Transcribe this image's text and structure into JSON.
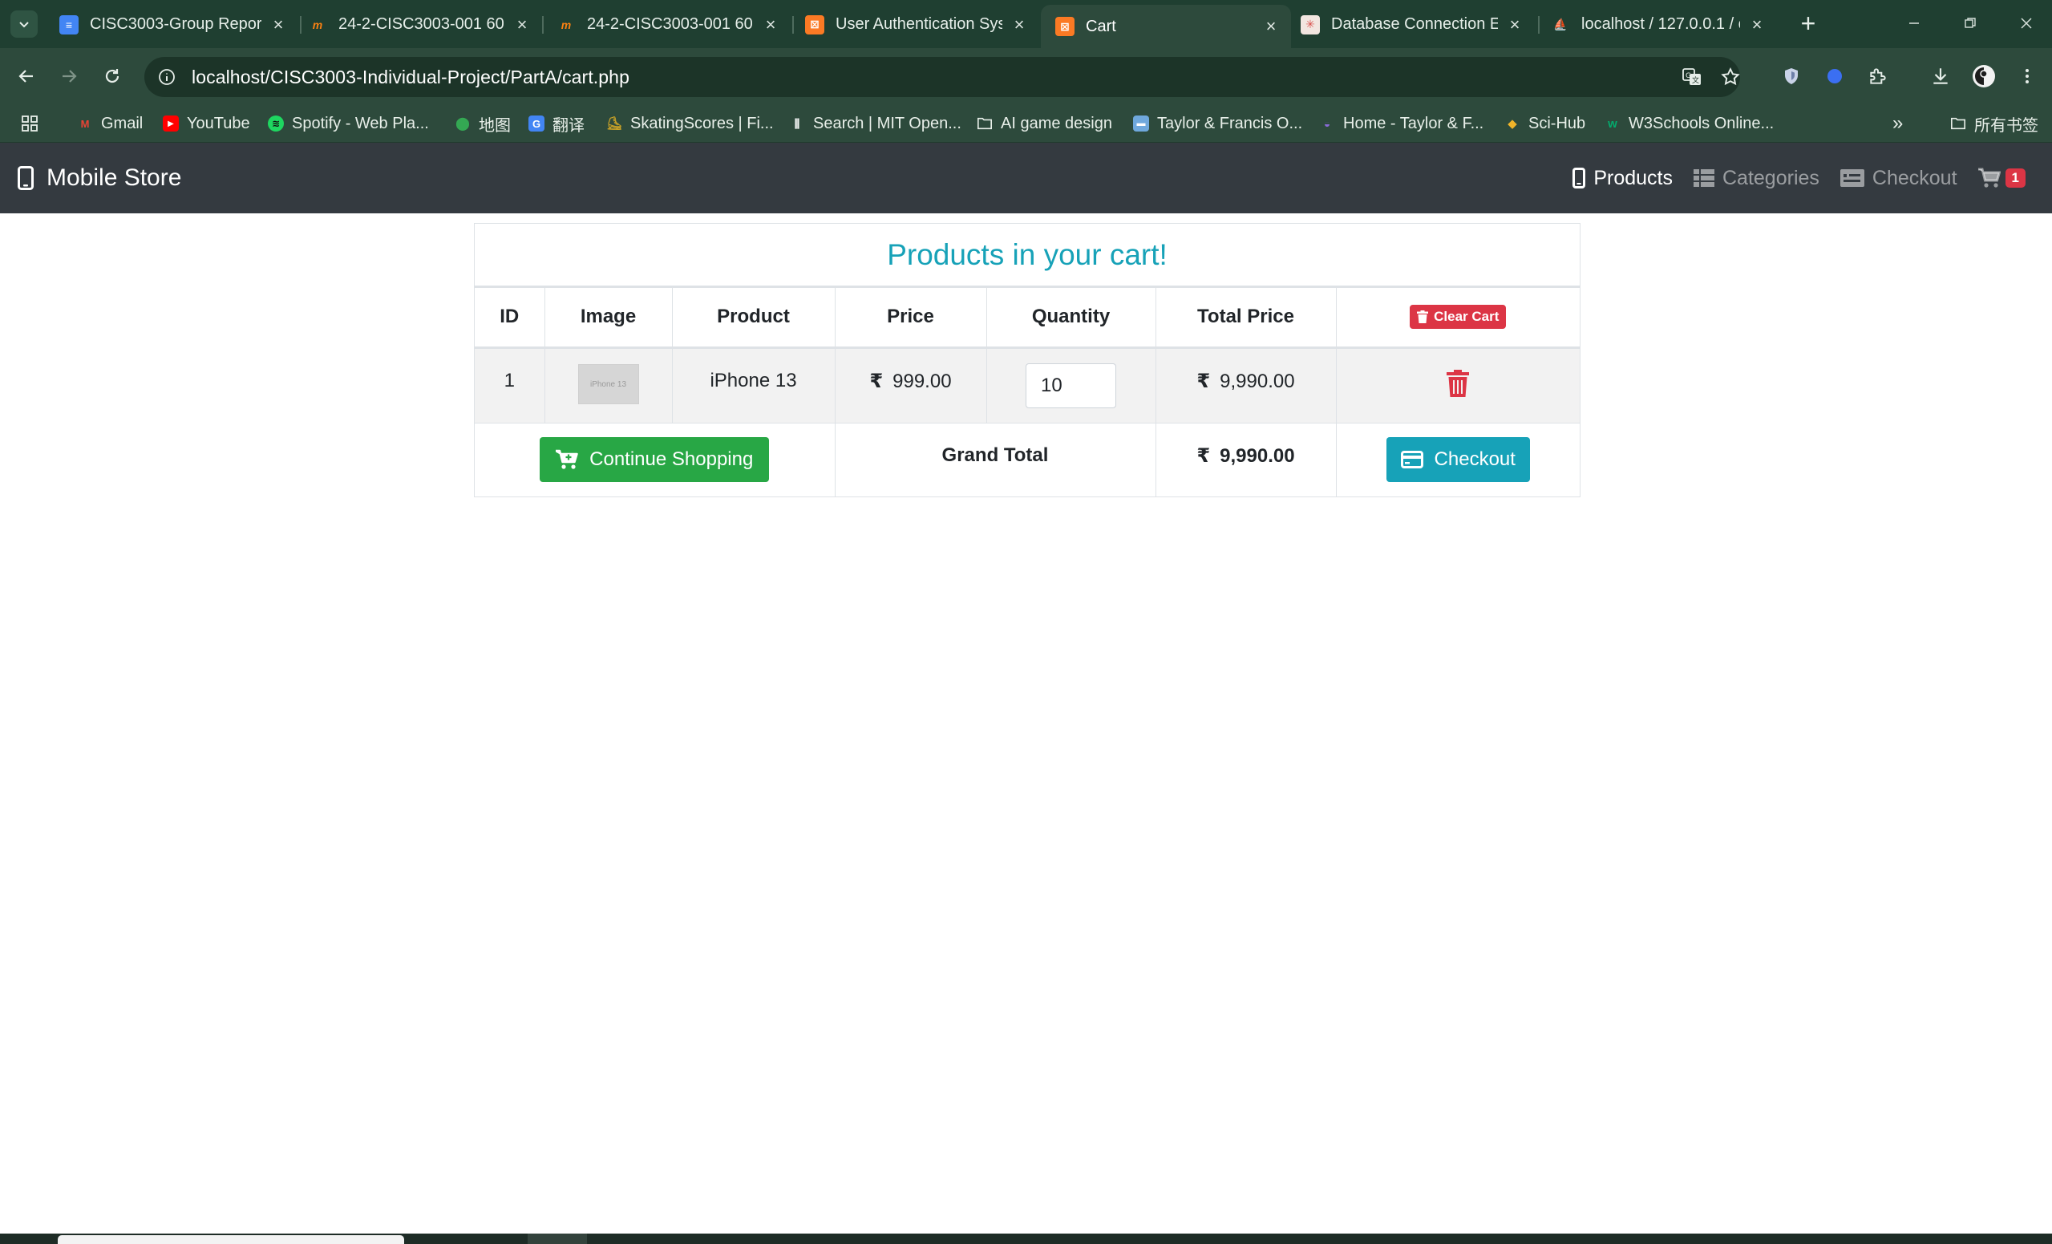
{
  "browser": {
    "tabs": [
      {
        "title": "CISC3003-Group Repor",
        "favicon": "docs-icon",
        "color": "#4285f4",
        "active": false
      },
      {
        "title": "24-2-CISC3003-001 60(",
        "favicon": "moodle-icon",
        "color": "#f98012",
        "active": false
      },
      {
        "title": "24-2-CISC3003-001 60(",
        "favicon": "moodle-icon",
        "color": "#f98012",
        "active": false
      },
      {
        "title": "User Authentication Sys",
        "favicon": "xampp-icon",
        "color": "#fb7a24",
        "active": false
      },
      {
        "title": "Cart",
        "favicon": "xampp-icon",
        "color": "#fb7a24",
        "active": true
      },
      {
        "title": "Database Connection E",
        "favicon": "localhost-icon",
        "color": "#e8e8e8",
        "active": false
      },
      {
        "title": "localhost / 127.0.0.1 / c",
        "favicon": "phpmyadmin-icon",
        "color": "#f0a030",
        "active": false
      }
    ],
    "url": "localhost/CISC3003-Individual-Project/PartA/cart.php",
    "bookmarks": [
      {
        "label": "Gmail",
        "icon": "gmail-icon",
        "color": "#ea4335"
      },
      {
        "label": "YouTube",
        "icon": "youtube-icon",
        "color": "#ff0000"
      },
      {
        "label": "Spotify - Web Pla...",
        "icon": "spotify-icon",
        "color": "#1ed760"
      },
      {
        "label": "地图",
        "icon": "maps-icon",
        "color": "#34a853"
      },
      {
        "label": "翻译",
        "icon": "translate-icon",
        "color": "#4285f4"
      },
      {
        "label": "SkatingScores | Fi...",
        "icon": "skater-icon",
        "color": "#c9a227"
      },
      {
        "label": "Search | MIT Open...",
        "icon": "mit-icon",
        "color": "#ffffff"
      },
      {
        "label": "AI game design",
        "icon": "folder-icon",
        "color": "#e8efe9"
      },
      {
        "label": "Taylor & Francis O...",
        "icon": "tandf-icon",
        "color": "#6fa8dc"
      },
      {
        "label": "Home - Taylor & F...",
        "icon": "tandf-home-icon",
        "color": "#5b3fa0"
      },
      {
        "label": "Sci-Hub",
        "icon": "scihub-icon",
        "color": "#f0b429"
      },
      {
        "label": "W3Schools Online...",
        "icon": "w3schools-icon",
        "color": "#04aa6d"
      }
    ],
    "other_bookmarks": "所有书签"
  },
  "page": {
    "brand": "Mobile Store",
    "nav": {
      "products": "Products",
      "categories": "Categories",
      "checkout": "Checkout",
      "cart_count": "1"
    },
    "cart": {
      "heading": "Products in your cart!",
      "columns": [
        "ID",
        "Image",
        "Product",
        "Price",
        "Quantity",
        "Total Price"
      ],
      "clear_label": "Clear Cart",
      "rows": [
        {
          "id": "1",
          "image_alt": "iPhone 13",
          "product": "iPhone 13",
          "price": "999.00",
          "quantity": "10",
          "total": "9,990.00"
        }
      ],
      "continue_label": "Continue Shopping",
      "grand_total_label": "Grand Total",
      "grand_total": "9,990.00",
      "checkout_label": "Checkout",
      "currency_symbol": "₹"
    }
  },
  "colors": {
    "accent": "#17a2b8",
    "success": "#28a745",
    "danger": "#dc3545",
    "navbar": "#343a40",
    "chrome": "#2d4a3c"
  }
}
